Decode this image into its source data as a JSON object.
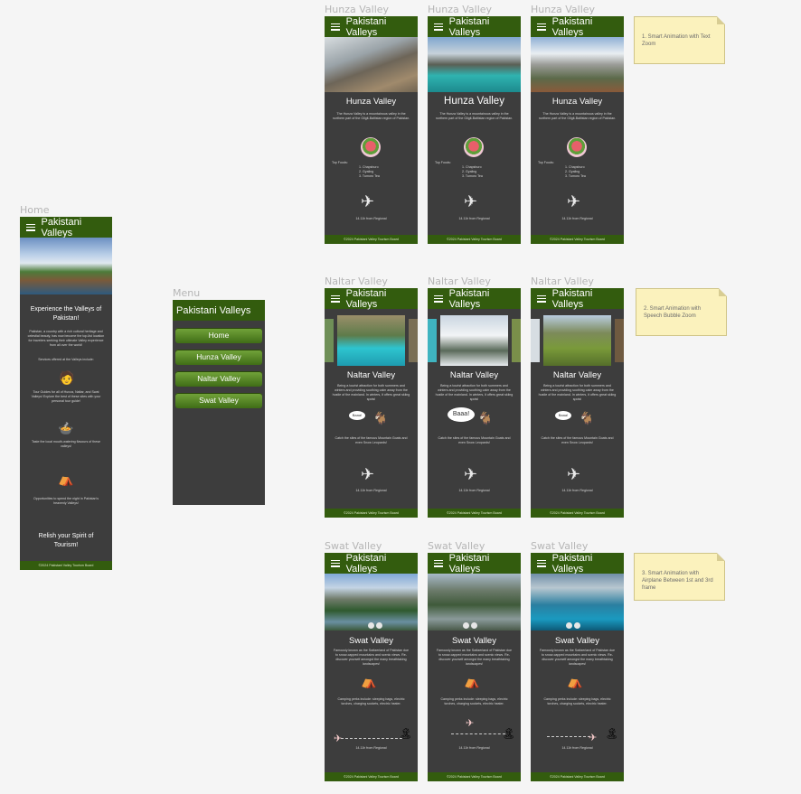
{
  "app_title": "Pakistani Valleys",
  "footer": "©2024 Pakistani Valley Tourism Board",
  "frame_labels": {
    "home": "Home",
    "menu": "Menu",
    "hunza": "Hunza Valley",
    "naltar": "Naltar Valley",
    "swat": "Swat Valley"
  },
  "home": {
    "headline": "Experience the Valleys of Pakistan!",
    "intro": "Pakistan, a country with a rich cultural heritage and celestial beauty, has now become the top-list location for travelers seeking their ultimate Valley experience from all over the world!",
    "services_heading": "Services offered at the Valleys include:",
    "service_1": "Tour Guides for all of Hunza, Naltar, and Swat Valleys! Explore the best of these sites with your personal tour guide!",
    "service_2": "Taste the local mouth-watering flavours of these valleys!",
    "service_3": "Opportunities to spend the night in Pakistan's heavenly Valleys!",
    "closing": "Relish your Spirit of Tourism!"
  },
  "menu": {
    "items": [
      "Home",
      "Hunza Valley",
      "Naltar Valley",
      "Swat Valley"
    ]
  },
  "hunza": {
    "title": "Hunza Valley",
    "description": "The Hunza Valley is a mountainous valley in the northern part of the Gilgit-Baltistan region of Pakistan.",
    "foods_heading": "Top Foods:",
    "foods": [
      "1. Chapshuro",
      "2. Gyaling",
      "3. Tumoro Tea"
    ],
    "distance_1": "14.11h from Regional",
    "distance_2": "14.11h from Regional",
    "distance_3": "14.11h from Regional"
  },
  "naltar": {
    "title": "Naltar Valley",
    "description": "Being a tourist attraction for both summers and winters and providing soothing calm away from the hustle of the mainland. In winters, it offers great skiing spots!",
    "bubble": "Baaa!",
    "goats_text": "Catch the sites of the famous Mountain Goats and even Snow Leopards!",
    "distance": "14.11h from Regional"
  },
  "swat": {
    "title": "Swat Valley",
    "description": "Famously known as the Switzerland of Pakistan due to snow-capped mountains and scenic views. Re-discover yourself amongst the many breathtaking landscapes!",
    "camping": "Camping perks include: sleeping bags, electric torches, charging sockets, electric heater.",
    "distance": "14.11h from Regional"
  },
  "notes": {
    "note_1": "1. Smart Animation with Text Zoom",
    "note_2": "2. Smart Animation with Speech Bubble Zoom",
    "note_3": "3. Smart Animation with Airplane Between 1st and 3rd frame"
  },
  "colors": {
    "header": "#335c0e",
    "frame_bg": "#3d3d3d",
    "note_bg": "#fbf2bd",
    "button_top": "#74a53b",
    "button_bottom": "#3f6d16"
  }
}
